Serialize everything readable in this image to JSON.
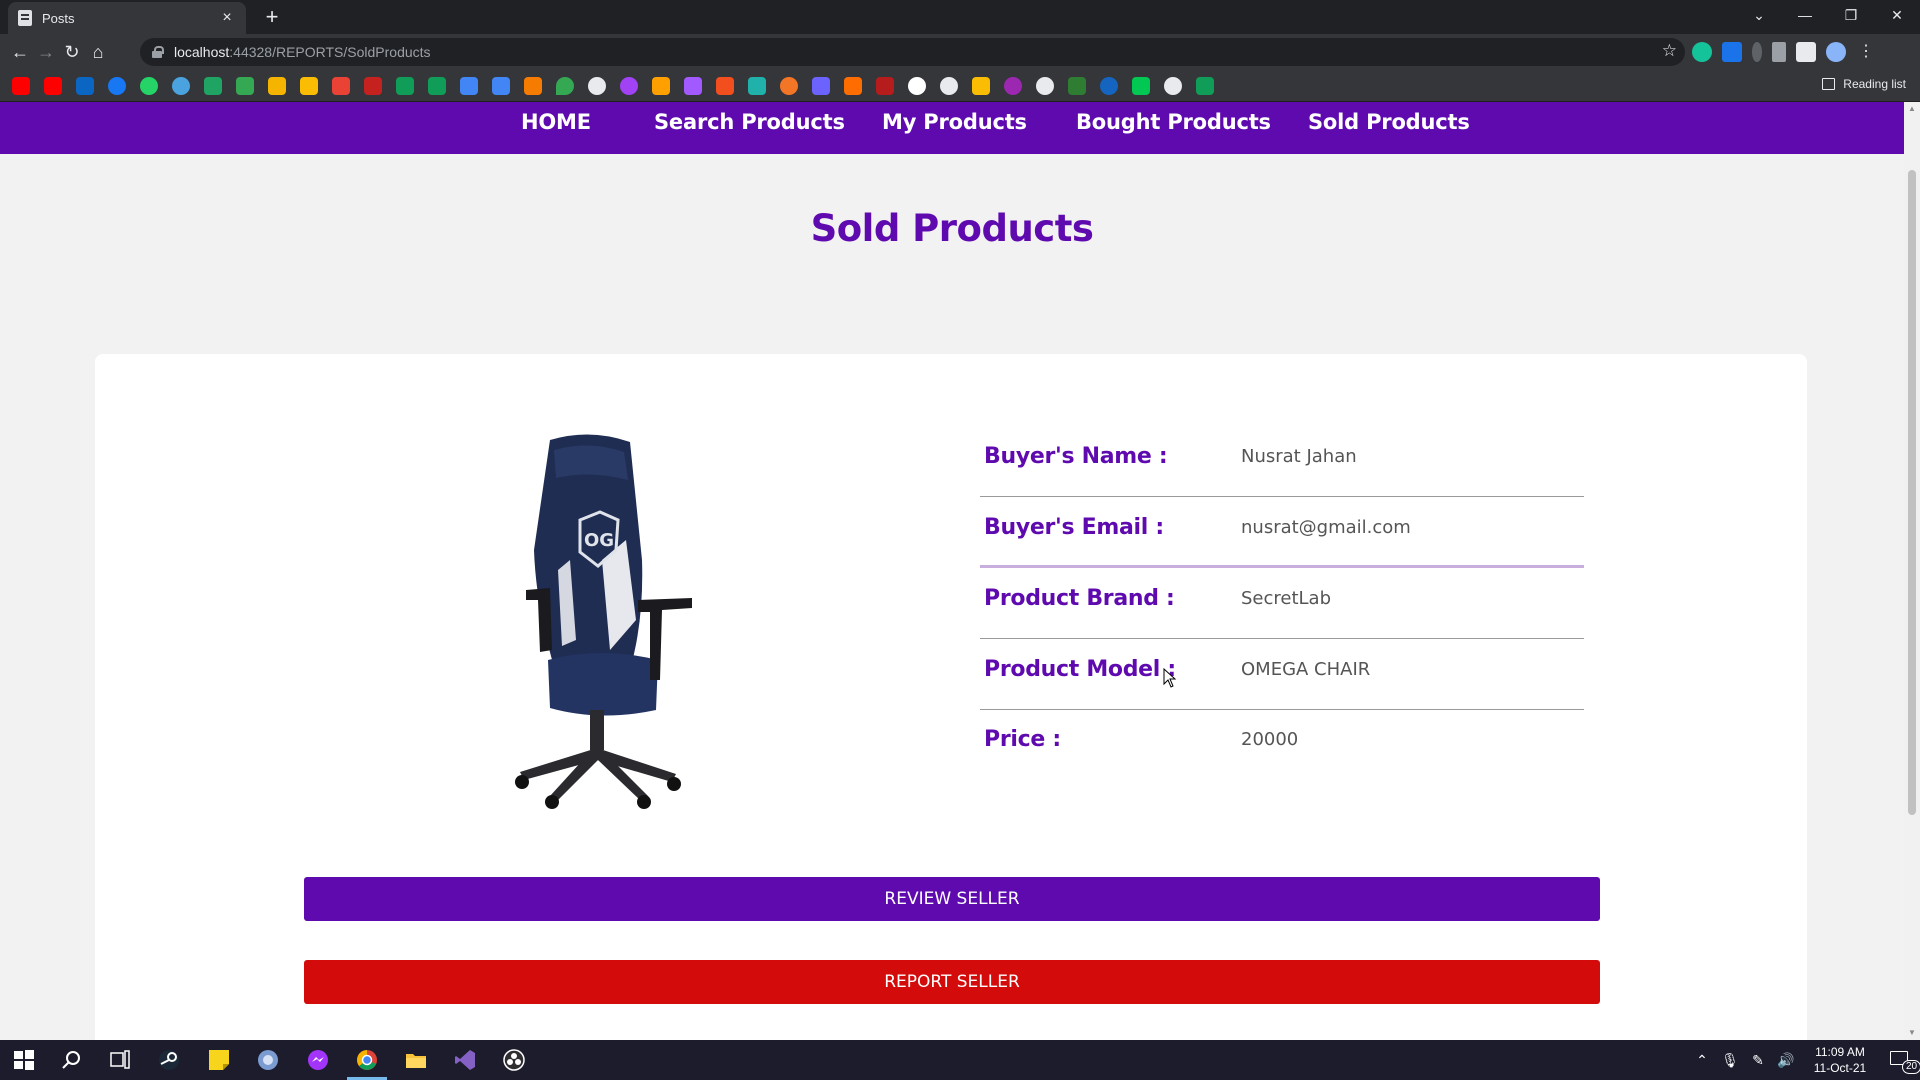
{
  "browser": {
    "tab_title": "Posts",
    "tab_close_icon": "close-icon",
    "new_tab_icon": "plus-icon",
    "url_host": "localhost",
    "url_path": ":44328/REPORTS/SoldProducts",
    "reading_list_label": "Reading list"
  },
  "site_nav": {
    "items": [
      {
        "label": "HOME"
      },
      {
        "label": "Search Products"
      },
      {
        "label": "My Products"
      },
      {
        "label": "Bought Products"
      },
      {
        "label": "Sold Products"
      }
    ]
  },
  "page": {
    "title": "Sold Products"
  },
  "product": {
    "image": "gaming-chair-image",
    "image_brand_mark": "OG",
    "details": [
      {
        "label": "Buyer's Name :",
        "value": "Nusrat Jahan"
      },
      {
        "label": "Buyer's Email :",
        "value": "nusrat@gmail.com"
      },
      {
        "label": "Product Brand :",
        "value": "SecretLab"
      },
      {
        "label": "Product Model :",
        "value": "OMEGA CHAIR"
      },
      {
        "label": "Price :",
        "value": "20000"
      }
    ]
  },
  "actions": {
    "review_label": "REVIEW SELLER",
    "report_label": "REPORT SELLER"
  },
  "colors": {
    "brand_purple": "#5f0aaf",
    "report_red": "#d40b0b",
    "email_divider": "#c7aedd"
  },
  "taskbar": {
    "time": "11:09 AM",
    "date": "11-Oct-21",
    "notification_count": "20"
  }
}
